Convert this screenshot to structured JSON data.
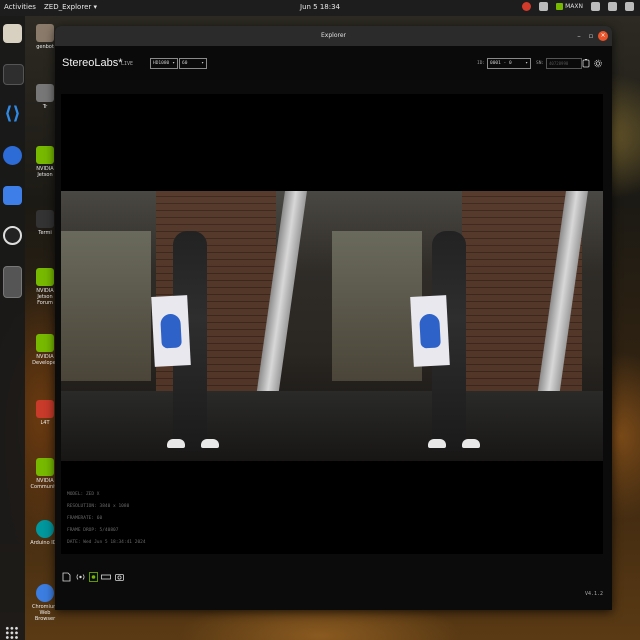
{
  "topbar": {
    "activities": "Activities",
    "app_menu": "ZED_Explorer ▾",
    "clock": "Jun 5  18:34",
    "power_mode": "MAXN"
  },
  "desktop_icons": [
    {
      "label": "genbot"
    },
    {
      "label": "Tr"
    },
    {
      "label": "NVIDIA Jetson"
    },
    {
      "label": "Termi"
    },
    {
      "label": "NVIDIA Jetson Forum"
    },
    {
      "label": "NVIDIA Developer"
    },
    {
      "label": "L4T"
    },
    {
      "label": "NVIDIA Community"
    },
    {
      "label": "Arduino IDE"
    },
    {
      "label": "Chromium Web Browser"
    }
  ],
  "window": {
    "title": "Explorer",
    "brand": "StereoLabs*",
    "mode": "LIVE",
    "resolution_select": "HD1080",
    "fps_select": "60",
    "id_label": "ID:",
    "camera_select": "0001 - 0",
    "sn_label": "SN:",
    "sn_placeholder": "40728998",
    "version": "V4.1.2"
  },
  "metadata": {
    "model": "MODEL: ZED X",
    "resolution": "RESOLUTION: 3840 x 1080",
    "framerate": "FRAMERATE: 60",
    "frame_drop": "FRAME DROP: 5/40807",
    "date": "DATE: Wed Jun 5 18:34:41 2024"
  },
  "colors": {
    "accent": "#76b900",
    "close_button": "#e9542a",
    "background": "#000000"
  }
}
